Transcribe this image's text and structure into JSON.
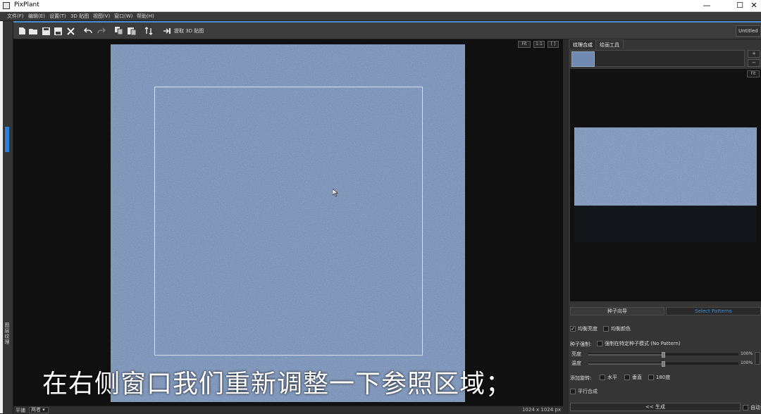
{
  "window": {
    "title": "PixPlant",
    "minimize": "—",
    "maximize": "☐",
    "close": "✕"
  },
  "menu": [
    "文件(F)",
    "编辑(E)",
    "设置(T)",
    "3D 贴图",
    "视图(V)",
    "窗口(W)",
    "帮助(H)"
  ],
  "toolbar": {
    "extract_label": "提取 3D 贴图",
    "untitled_tab": "Untitled"
  },
  "viewport": {
    "buttons": [
      "Fit",
      "1:1",
      "[ ]"
    ]
  },
  "subtitle": "在右侧窗口我们重新调整一下参照区域；",
  "statusbar": {
    "tile_label": "平铺",
    "tile_value": "两者",
    "image_size": "1024 x 1024 px"
  },
  "left_strip": {
    "vertical_text": "图层 纹理"
  },
  "right_panel": {
    "tabs": [
      "纹理合成",
      "绘画工具"
    ],
    "strip_buttons": [
      "+",
      "−"
    ],
    "fit_label": "Fit",
    "seed_guide_label": "种子向导",
    "select_pattern_label": "Select Patterns",
    "balance_brightness": "均衡亮度",
    "balance_color": "均衡颜色",
    "seed_label": "种子强制:",
    "seed_option": "强制在特定种子模式 (No Pattern)",
    "brightness_label": "亮度",
    "brightness_value": "100%",
    "temperature_label": "温度",
    "temperature_value": "100%",
    "add_rotation_label": "添加旋转:",
    "rotate_h": "水平",
    "rotate_v": "垂直",
    "rotate_180": "180度",
    "parallel_label": "平行合成",
    "generate_label": "<< 生成",
    "auto_label": "自动"
  },
  "colors": {
    "texture": "#6b85ad",
    "accent": "#4a8fd8",
    "select_pattern_text": "#3b8fe0"
  }
}
